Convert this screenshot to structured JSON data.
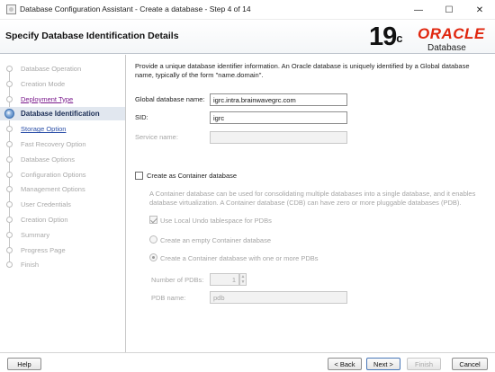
{
  "window": {
    "title": "Database Configuration Assistant - Create a database - Step 4 of 14",
    "minimize_glyph": "—",
    "maximize_glyph": "☐",
    "close_glyph": "✕"
  },
  "header": {
    "title": "Specify Database Identification Details",
    "logo_version": "19",
    "logo_version_suffix": "c",
    "logo_brand": "ORACLE",
    "logo_product": "Database"
  },
  "sidebar": {
    "steps": [
      {
        "label": "Database Operation",
        "state": "inactive"
      },
      {
        "label": "Creation Mode",
        "state": "inactive"
      },
      {
        "label": "Deployment Type",
        "state": "visited"
      },
      {
        "label": "Database Identification",
        "state": "current"
      },
      {
        "label": "Storage Option",
        "state": "link"
      },
      {
        "label": "Fast Recovery Option",
        "state": "inactive"
      },
      {
        "label": "Database Options",
        "state": "inactive"
      },
      {
        "label": "Configuration Options",
        "state": "inactive"
      },
      {
        "label": "Management Options",
        "state": "inactive"
      },
      {
        "label": "User Credentials",
        "state": "inactive"
      },
      {
        "label": "Creation Option",
        "state": "inactive"
      },
      {
        "label": "Summary",
        "state": "inactive"
      },
      {
        "label": "Progress Page",
        "state": "inactive"
      },
      {
        "label": "Finish",
        "state": "inactive"
      }
    ]
  },
  "main": {
    "description": "Provide a unique database identifier information. An Oracle database is uniquely identified by a Global database name, typically of the form \"name.domain\".",
    "global_db_name": {
      "label": "Global database name:",
      "value": "igrc.intra.brainwavegrc.com"
    },
    "sid": {
      "label": "SID:",
      "value": "igrc"
    },
    "service_name": {
      "label": "Service name:",
      "value": ""
    },
    "container_db": {
      "label": "Create as Container database",
      "checked": false,
      "note": "A Container database can be used for consolidating multiple databases into a single database, and it enables database virtualization. A Container database (CDB) can have zero or more pluggable databases (PDB).",
      "local_undo": {
        "label": "Use Local Undo tablespace for PDBs",
        "checked": true
      },
      "empty_container": {
        "label": "Create an empty Container database",
        "selected": false
      },
      "with_pdbs": {
        "label": "Create a Container database with one or more PDBs",
        "selected": true
      },
      "num_pdbs": {
        "label": "Number of PDBs:",
        "value": "1"
      },
      "pdb_name": {
        "label": "PDB name:",
        "value": "pdb"
      }
    }
  },
  "footer": {
    "help": "Help",
    "back": "< Back",
    "next": "Next >",
    "finish": "Finish",
    "cancel": "Cancel"
  },
  "colors": {
    "oracle_red": "#e0260e",
    "current_step_bg": "#e1e7ef",
    "visited_link": "#7a1a8c",
    "link": "#2b4fa8"
  }
}
